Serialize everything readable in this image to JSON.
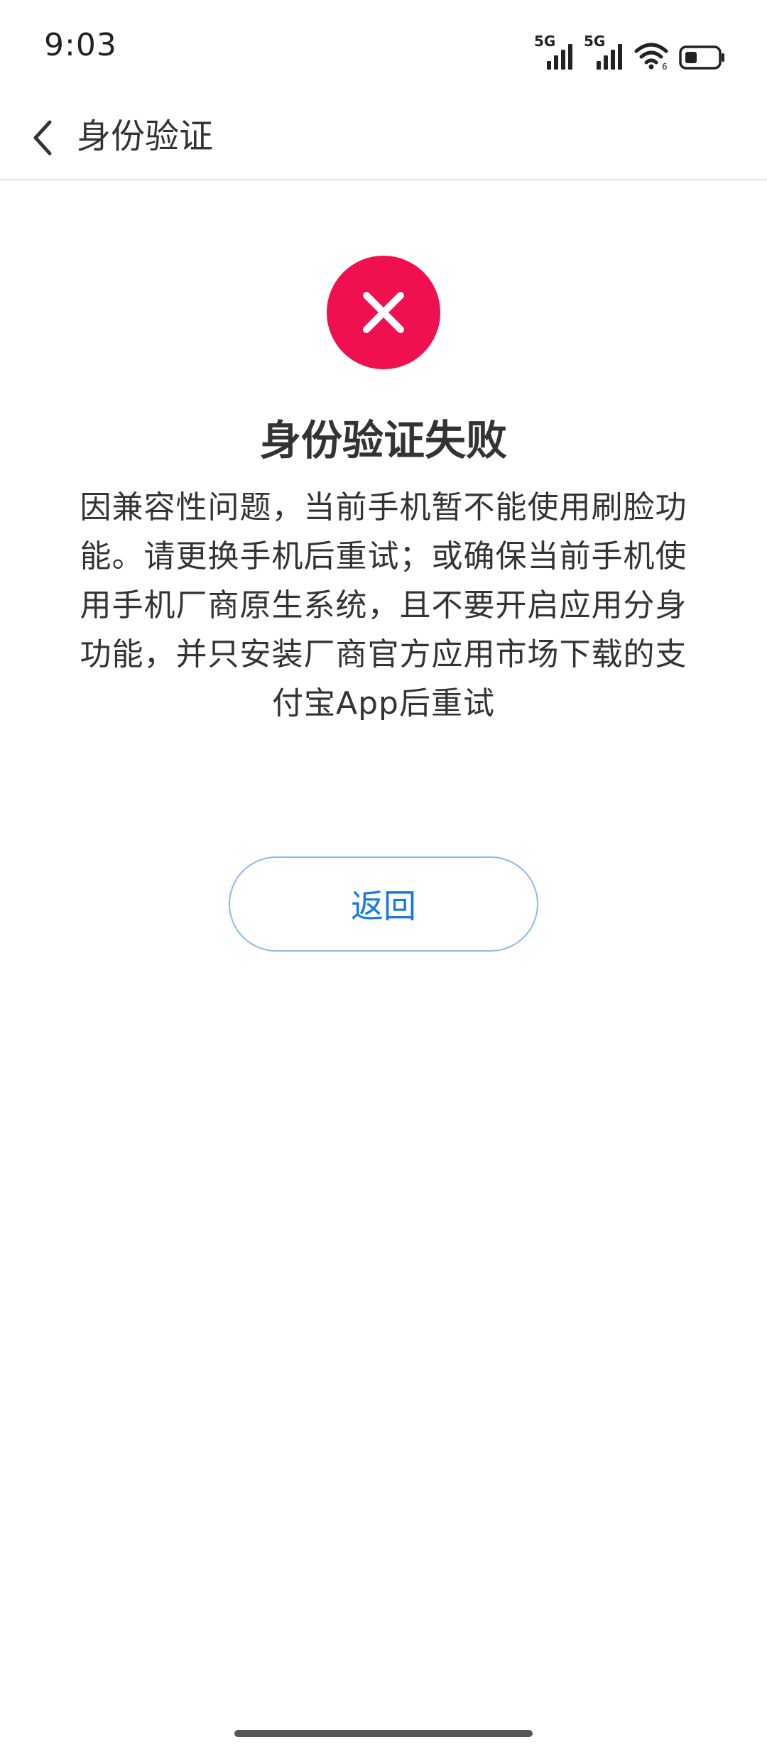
{
  "status_bar": {
    "time": "9:03",
    "network1": "5G",
    "network2": "5G",
    "icons": [
      "signal-icon",
      "signal-icon",
      "wifi-icon",
      "battery-icon"
    ]
  },
  "header": {
    "title": "身份验证",
    "back_icon": "chevron-left-icon"
  },
  "result": {
    "icon": "close-icon",
    "icon_color": "#f0104f",
    "title": "身份验证失败",
    "description": "因兼容性问题，当前手机暂不能使用刷脸功能。请更换手机后重试；或确保当前手机使用手机厂商原生系统，且不要开启应用分身功能，并只安装厂商官方应用市场下载的支付宝App后重试"
  },
  "actions": {
    "return_label": "返回",
    "return_color": "#1677e6"
  }
}
